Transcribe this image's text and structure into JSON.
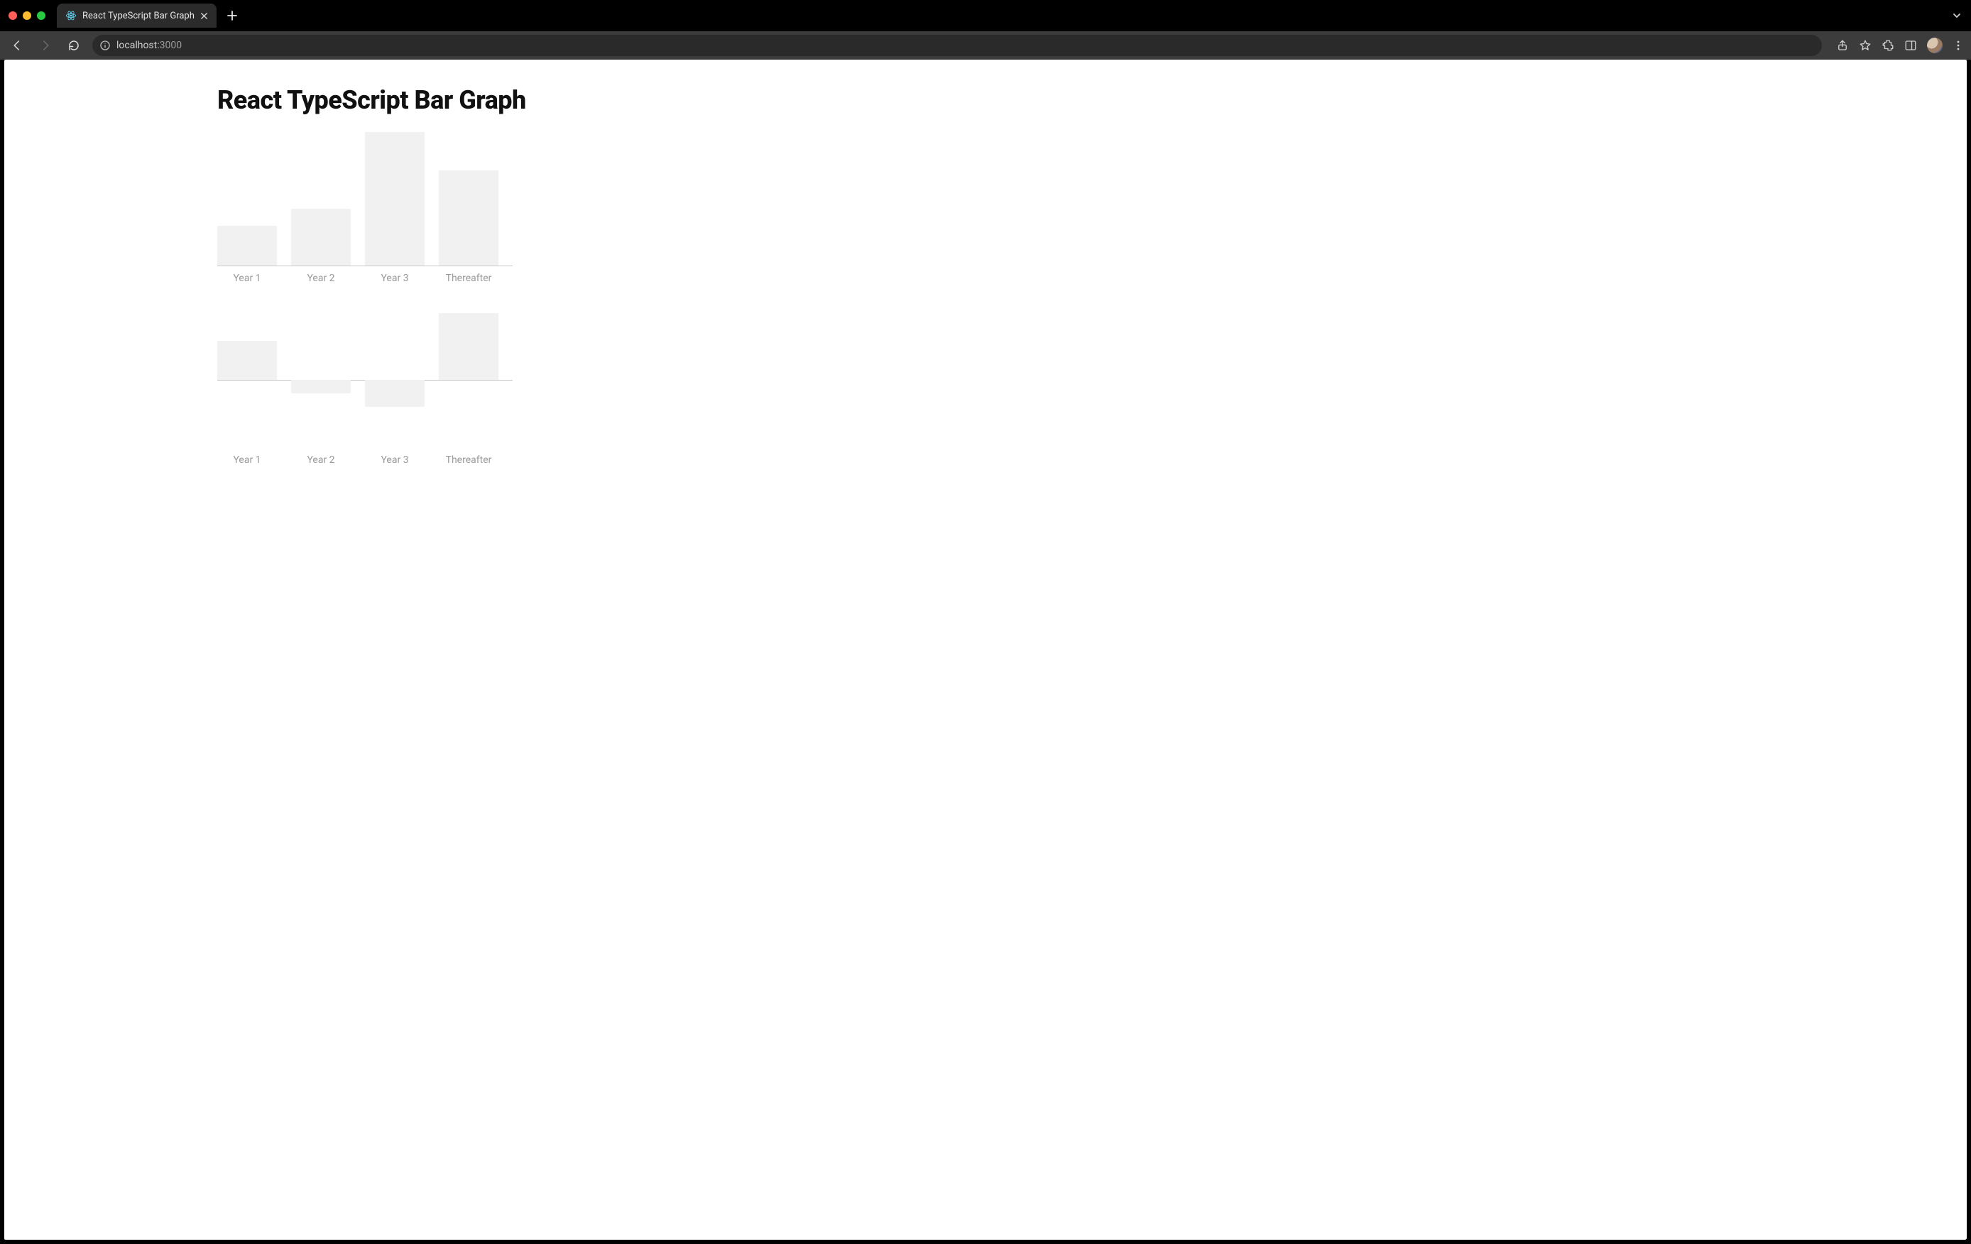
{
  "browser": {
    "tab_title": "React TypeScript Bar Graph",
    "url_host": "localhost:",
    "url_path": "3000"
  },
  "page": {
    "title": "React TypeScript Bar Graph"
  },
  "chart_data": [
    {
      "type": "bar",
      "categories": [
        "Year 1",
        "Year 2",
        "Year 3",
        "Thereafter"
      ],
      "values": [
        50,
        72,
        168,
        120
      ],
      "baseline": 0,
      "ylim": [
        0,
        170
      ],
      "title": "",
      "xlabel": "",
      "ylabel": ""
    },
    {
      "type": "bar",
      "categories": [
        "Year 1",
        "Year 2",
        "Year 3",
        "Thereafter"
      ],
      "values": [
        55,
        -19,
        -38,
        94
      ],
      "baseline": 0,
      "ylim": [
        -95,
        95
      ],
      "title": "",
      "xlabel": "",
      "ylabel": ""
    }
  ]
}
